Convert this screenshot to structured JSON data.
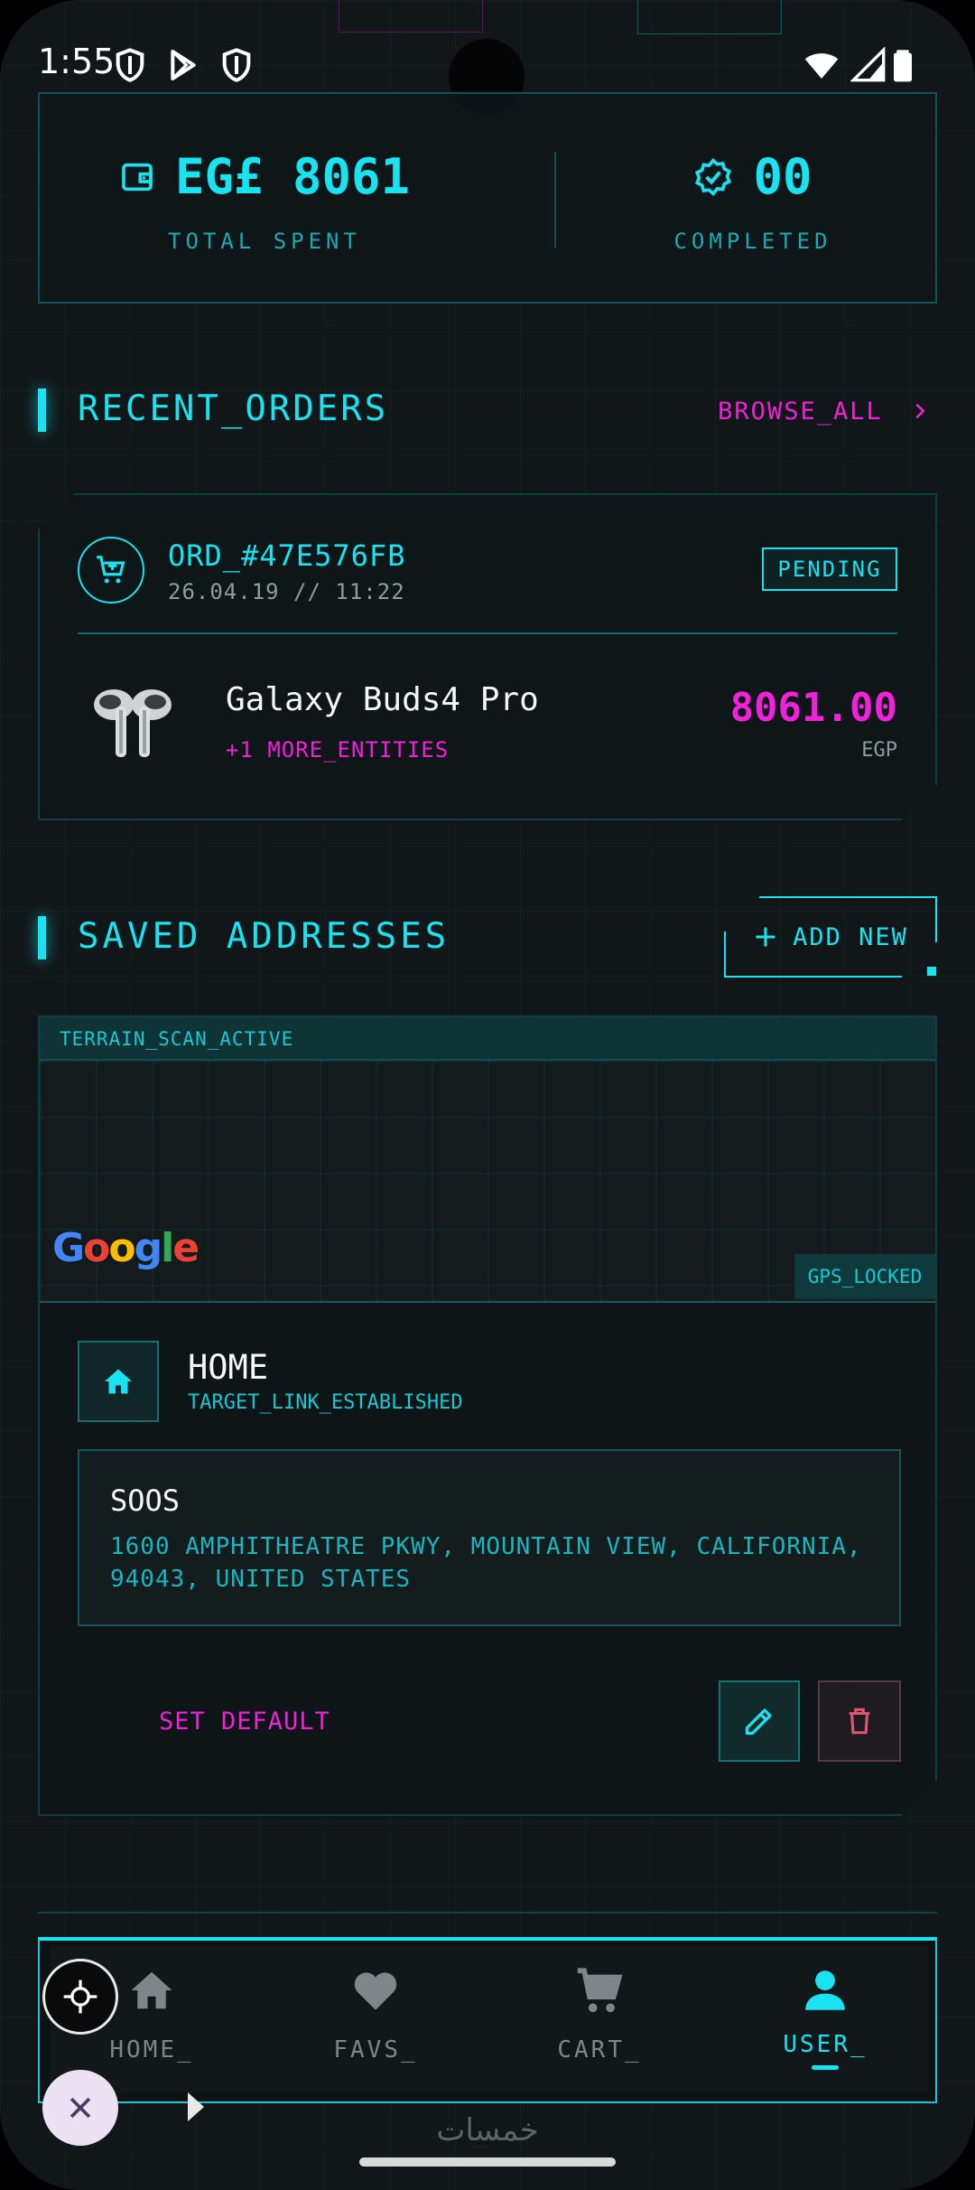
{
  "status_bar": {
    "time": "1:55"
  },
  "stats": {
    "total_spent_value": "EG£ 8061",
    "total_spent_label": "TOTAL SPENT",
    "completed_value": "00",
    "completed_label": "COMPLETED"
  },
  "recent_orders": {
    "title": "RECENT_ORDERS",
    "browse_all": "BROWSE_ALL",
    "order": {
      "id": "ORD_#47E576FB",
      "date": "26.04.19 // 11:22",
      "status": "PENDING",
      "product_name": "Galaxy Buds4 Pro",
      "more_entities": "+1 MORE_ENTITIES",
      "price": "8061.00",
      "currency": "EGP"
    }
  },
  "saved_addresses": {
    "title": "SAVED ADDRESSES",
    "add_new": "ADD NEW",
    "address": {
      "map_header": "TERRAIN_SCAN_ACTIVE",
      "gps_badge": "GPS_LOCKED",
      "map_provider": "Google",
      "name": "HOME",
      "link_status": "TARGET_LINK_ESTABLISHED",
      "title": "SOOS",
      "line": "1600 AMPHITHEATRE PKWY, MOUNTAIN VIEW, CALIFORNIA, 94043, UNITED STATES",
      "set_default": "SET DEFAULT"
    }
  },
  "bottom_nav": {
    "items": [
      {
        "label": "HOME_",
        "icon": "home-icon"
      },
      {
        "label": "FAVS_",
        "icon": "heart-icon"
      },
      {
        "label": "CART_",
        "icon": "cart-icon"
      },
      {
        "label": "USER_",
        "icon": "user-icon",
        "active": true
      }
    ]
  },
  "watermark": "خمسات",
  "colors": {
    "accent_cyan": "#19e3f0",
    "accent_magenta": "#f021d8",
    "background": "#111718"
  }
}
